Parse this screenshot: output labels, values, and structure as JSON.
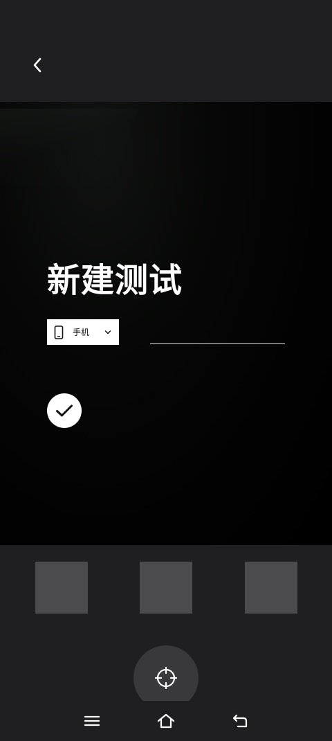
{
  "form": {
    "title": "新建测试",
    "device_select": {
      "selected": "手机",
      "icon": "phone-icon"
    },
    "name_input": {
      "value": "",
      "placeholder": ""
    },
    "confirm_icon": "check-icon"
  },
  "header": {
    "back_icon": "chevron-left-icon"
  },
  "gallery": {
    "thumbnail_count": 3
  },
  "camera": {
    "capture_icon": "crosshair-icon"
  },
  "system_nav": {
    "icons": [
      "menu-icon",
      "home-icon",
      "back-arrow-icon"
    ]
  },
  "colors": {
    "background": "#1f1f21",
    "viewfinder": "#000000",
    "thumbnail": "#4b4b4d",
    "shutter": "#39393b",
    "foreground": "#ffffff"
  }
}
